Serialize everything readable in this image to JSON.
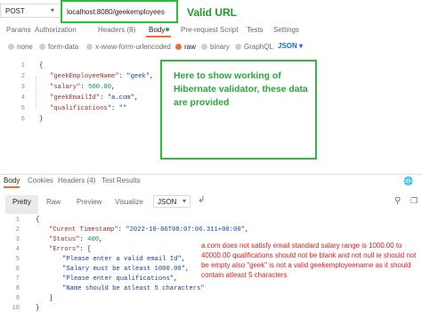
{
  "request": {
    "method": "POST",
    "url": "localhost:8080/geekemployees",
    "annotation": "Valid URL"
  },
  "request_tabs": [
    {
      "label": "Params",
      "active": false
    },
    {
      "label": "Authorization",
      "active": false
    },
    {
      "label": "Headers (8)",
      "active": false
    },
    {
      "label": "Body",
      "active": true
    },
    {
      "label": "Pre-request Script",
      "active": false
    },
    {
      "label": "Tests",
      "active": false
    },
    {
      "label": "Settings",
      "active": false
    }
  ],
  "body_types": [
    {
      "label": "none",
      "selected": false
    },
    {
      "label": "form-data",
      "selected": false
    },
    {
      "label": "x-www-form-urlencoded",
      "selected": false
    },
    {
      "label": "raw",
      "selected": true
    },
    {
      "label": "binary",
      "selected": false
    },
    {
      "label": "GraphQL",
      "selected": false
    }
  ],
  "raw_format": "JSON",
  "request_body": {
    "line_numbers": [
      "1",
      "2",
      "3",
      "4",
      "5",
      "6"
    ],
    "lines": [
      {
        "open": "{"
      },
      {
        "key": "\"geekEmployeeName\"",
        "sep": ": ",
        "value": "\"geek\"",
        "type": "str",
        "comma": ","
      },
      {
        "key": "\"salary\"",
        "sep": ": ",
        "value": "500.00",
        "type": "num",
        "comma": ","
      },
      {
        "key": "\"geekEmailId\"",
        "sep": ": ",
        "value": "\"a.com\"",
        "type": "str",
        "comma": ","
      },
      {
        "key": "\"qualifications\"",
        "sep": ": ",
        "value": "\"\"",
        "type": "str",
        "comma": ""
      },
      {
        "open": "}"
      }
    ]
  },
  "note": "Here to show working of Hibernate validator, these data are provided",
  "response_tabs": [
    {
      "label": "Body",
      "active": true
    },
    {
      "label": "Cookies",
      "active": false
    },
    {
      "label": "Headers (4)",
      "active": false
    },
    {
      "label": "Test Results",
      "active": false
    }
  ],
  "view_modes": [
    {
      "label": "Pretty",
      "active": true
    },
    {
      "label": "Raw",
      "active": false
    },
    {
      "label": "Preview",
      "active": false
    },
    {
      "label": "Visualize",
      "active": false
    }
  ],
  "response_format": "JSON",
  "response_body": {
    "line_numbers": [
      "1",
      "2",
      "3",
      "4",
      "5",
      "6",
      "7",
      "8",
      "9",
      "10"
    ],
    "open": "{",
    "timestamp_key": "\"Curent Timestamp\"",
    "timestamp_value": "\"2022-10-06T08:07:06.311+00:00\"",
    "status_key": "\"Status\"",
    "status_value": "400",
    "errors_key": "\"Errors\"",
    "errors": [
      "\"Please enter a valid email Id\"",
      "\"Salary must be atleast 1000.00\"",
      "\"Please enter qualifications\"",
      "\"Name should be atleast 5 characters\""
    ],
    "close_bracket": "]",
    "close": "}"
  },
  "error_note": "a.com does not satisfy email standard salary range is 1000.00 to 40000.00 qualifications should not be blank and not null ie should not be empty also \"geek\" is not a valid geekemployeename as it should contain atleast 5 characters",
  "colors": {
    "accent": "#f26b3a",
    "annotation_green": "#2dbd3c",
    "error_red": "#e0201c",
    "json_key": "#a22a2a",
    "json_string": "#0f3fa8",
    "json_number": "#128a5a"
  },
  "icons": [
    "chevron-down-icon",
    "globe-icon",
    "wrap-lines-icon",
    "filter-icon",
    "copy-icon"
  ]
}
